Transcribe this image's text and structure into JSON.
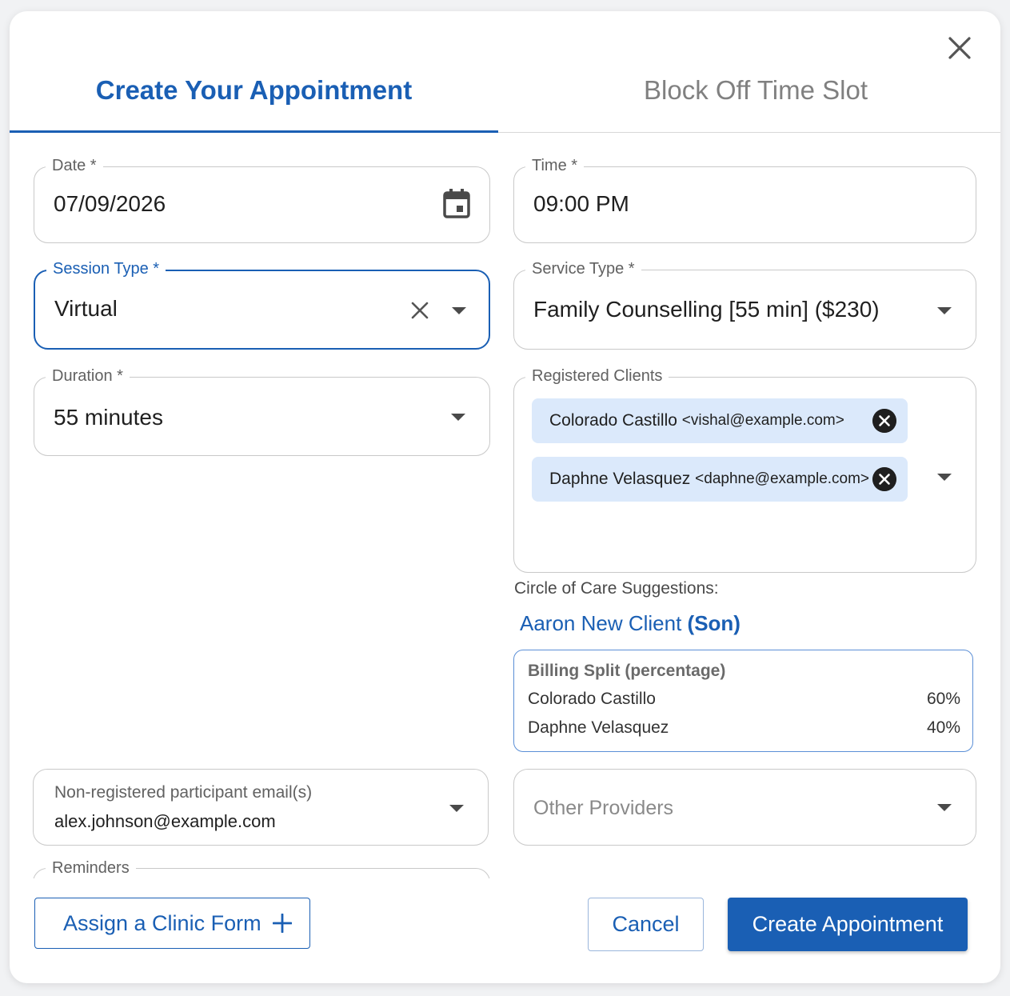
{
  "tabs": {
    "create": "Create Your Appointment",
    "block": "Block Off Time Slot"
  },
  "date": {
    "label": "Date *",
    "value": "07/09/2026"
  },
  "time": {
    "label": "Time *",
    "value": "09:00 PM"
  },
  "session_type": {
    "label": "Session Type *",
    "value": "Virtual"
  },
  "service_type": {
    "label": "Service Type *",
    "value": "Family Counselling [55 min] ($230)"
  },
  "duration": {
    "label": "Duration *",
    "value": "55 minutes"
  },
  "registered_clients": {
    "label": "Registered Clients",
    "chips": [
      {
        "name": "Colorado Castillo",
        "email": "<vishal@example.com>"
      },
      {
        "name": "Daphne Velasquez",
        "email": "<daphne@example.com>"
      }
    ]
  },
  "circle_of_care": {
    "label": "Circle of Care Suggestions:",
    "suggestion_name": "Aaron New Client",
    "suggestion_relation": "(Son)"
  },
  "billing_split": {
    "title": "Billing Split (percentage)",
    "rows": [
      {
        "name": "Colorado Castillo",
        "percent": "60%"
      },
      {
        "name": "Daphne Velasquez",
        "percent": "40%"
      }
    ]
  },
  "non_registered": {
    "label": "Non-registered participant email(s)",
    "value": "alex.johnson@example.com"
  },
  "other_providers": {
    "placeholder": "Other Providers"
  },
  "reminders": {
    "label": "Reminders"
  },
  "buttons": {
    "assign_form": "Assign a Clinic Form",
    "cancel": "Cancel",
    "create": "Create Appointment"
  },
  "colors": {
    "accent": "#1a5fb4",
    "chip_bg": "#dbe9fb",
    "border": "#c9c9c9"
  },
  "icons": [
    "close-icon",
    "calendar-icon",
    "clear-icon",
    "chevron-down-icon",
    "chip-remove-icon",
    "plus-icon"
  ]
}
